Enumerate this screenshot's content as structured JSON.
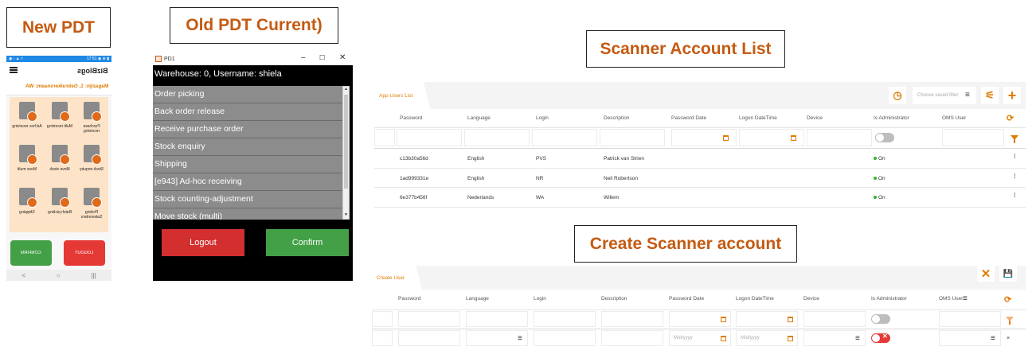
{
  "callouts": {
    "new_pdt": "New PDT",
    "old_pdt": "Old PDT Current)",
    "scanner_list": "Scanner Account List",
    "create_scanner": "Create Scanner account"
  },
  "new_pdt": {
    "status_left": "◉ ⁝ ▲ ≈",
    "status_right": "17:51 ◉ ⊕ ▮",
    "title": "BizBlogs",
    "subtitle": "Magazijn: 1, Gebruikersnaam: WA",
    "tiles": [
      {
        "label": "Purchase receiving",
        "icon": "clipboard-truck-icon"
      },
      {
        "label": "Multi receiving",
        "icon": "multi-receive-icon"
      },
      {
        "label": "Ad-hoc receiving",
        "icon": "adhoc-receive-icon"
      },
      {
        "label": "Stock enquiry",
        "icon": "stock-enquiry-icon"
      },
      {
        "label": "Move stock",
        "icon": "move-stock-icon"
      },
      {
        "label": "Move multi",
        "icon": "move-multi-icon"
      },
      {
        "label": "Picking Salesorders",
        "icon": "picking-icon"
      },
      {
        "label": "Batch picking",
        "icon": "batch-picking-icon"
      },
      {
        "label": "Shipping",
        "icon": "truck-icon"
      }
    ],
    "logout_label": "LOGOUT",
    "confirm_label": "CONFIRM",
    "nav_back": "<",
    "nav_home": "○",
    "nav_recent": "|||"
  },
  "old_pdt": {
    "window_title": "PD1",
    "min": "–",
    "max": "☐",
    "close": "✕",
    "header": "Warehouse: 0, Username: shiela",
    "menu": [
      "Order picking",
      "Back order release",
      "Receive purchase order",
      "Stock enquiry",
      "Shipping",
      "[e943] Ad-hoc receiving",
      "Stock counting-adjustment",
      "Move stock (multi)"
    ],
    "logout_label": "Logout",
    "confirm_label": "Confirm",
    "colors": {
      "logout": "#d32f2f",
      "confirm": "#43a047"
    }
  },
  "list_panel": {
    "tab": "App Users List",
    "saved_filter_placeholder": "Choose saved filter",
    "columns": [
      "Password",
      "Language",
      "Login",
      "Description",
      "Password Date",
      "Logon DateTime",
      "Device",
      "Is Administrator",
      "OMS User"
    ],
    "rows": [
      {
        "password": "c13b30a56d",
        "language": "English",
        "login": "PVS",
        "description": "Patrick van Strien",
        "admin": "On"
      },
      {
        "password": "1ad999331e",
        "language": "English",
        "login": "NR",
        "description": "Neil Robertson",
        "admin": "On"
      },
      {
        "password": "6e377b456f",
        "language": "Nederlands",
        "login": "WA",
        "description": "Willem",
        "admin": "On"
      }
    ]
  },
  "create_panel": {
    "tab": "Create User",
    "columns": [
      "Password",
      "Language",
      "Login",
      "Description",
      "Password Date",
      "Logon DateTime",
      "Device",
      "Is Administrator",
      "OMS User"
    ],
    "date_placeholder": "M/d/yyyy",
    "close_icon": "✕",
    "save_icon": "💾"
  },
  "accent_color": "#e07b00"
}
